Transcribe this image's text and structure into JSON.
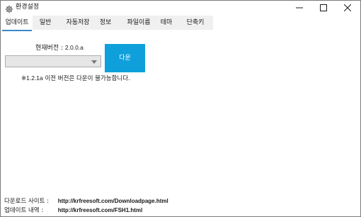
{
  "window": {
    "title": "환경설정",
    "icon": "gear-icon",
    "controls": [
      "minimize-icon",
      "maximize-icon",
      "close-icon"
    ]
  },
  "tabs": [
    {
      "label": "업데이트",
      "active": true
    },
    {
      "label": "일반",
      "active": false
    },
    {
      "label": "자동저장",
      "active": false
    },
    {
      "label": "정보",
      "active": false
    },
    {
      "label": "파일이름",
      "active": false
    },
    {
      "label": "테마",
      "active": false
    },
    {
      "label": "단축키",
      "active": false
    }
  ],
  "update": {
    "current_version_label": "현재버전 :",
    "current_version_value": "2.0.0.a",
    "version_select_value": "",
    "download_button_label": "다운",
    "note_prefix": "※",
    "note_version": "1.2.1a",
    "note_text": " 이전 버전은 다운이 불가능합니다."
  },
  "footer": {
    "download_site_label": "다운로드 사이트 :",
    "download_site_url": "http://krfreesoft.com/Downloadpage.html",
    "update_history_label": "업데이트 내역 :",
    "update_history_url": "http://krfreesoft.com/FSH1.html"
  },
  "colors": {
    "accent": "#0fa0dc",
    "tab_underline": "#3c87c8",
    "tab_strip": "#f0f0f0"
  }
}
